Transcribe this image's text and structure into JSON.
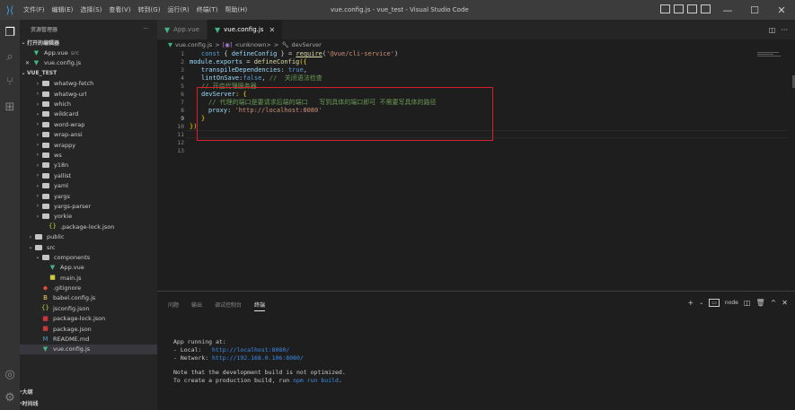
{
  "titlebar": {
    "menu": [
      "文件(F)",
      "编辑(E)",
      "选择(S)",
      "查看(V)",
      "转到(G)",
      "运行(R)",
      "终端(T)",
      "帮助(H)"
    ],
    "title": "vue.config.js - vue_test - Visual Studio Code",
    "minimize": "—",
    "maximize": "☐",
    "close": "✕"
  },
  "sidebar": {
    "header": "资源管理器",
    "more": "···",
    "open_editors_label": "打开的编辑器",
    "open_editors": [
      {
        "name": "App.vue",
        "sub": "src",
        "icon": "vue-icon",
        "modified_mark": ""
      },
      {
        "name": "vue.config.js",
        "sub": "",
        "icon": "vue-icon",
        "modified_mark": "✕"
      }
    ],
    "project_label": "VUE_TEST",
    "tree": [
      {
        "label": "whatwg-fetch",
        "indent": 1,
        "kind": "folder"
      },
      {
        "label": "whatwg-url",
        "indent": 1,
        "kind": "folder"
      },
      {
        "label": "which",
        "indent": 1,
        "kind": "folder"
      },
      {
        "label": "wildcard",
        "indent": 1,
        "kind": "folder"
      },
      {
        "label": "word-wrap",
        "indent": 1,
        "kind": "folder"
      },
      {
        "label": "wrap-ansi",
        "indent": 1,
        "kind": "folder"
      },
      {
        "label": "wrappy",
        "indent": 1,
        "kind": "folder"
      },
      {
        "label": "ws",
        "indent": 1,
        "kind": "folder"
      },
      {
        "label": "y18n",
        "indent": 1,
        "kind": "folder"
      },
      {
        "label": "yallist",
        "indent": 1,
        "kind": "folder"
      },
      {
        "label": "yaml",
        "indent": 1,
        "kind": "folder"
      },
      {
        "label": "yargs",
        "indent": 1,
        "kind": "folder"
      },
      {
        "label": "yargs-parser",
        "indent": 1,
        "kind": "folder"
      },
      {
        "label": "yorkie",
        "indent": 1,
        "kind": "folder"
      },
      {
        "label": ".package-lock.json",
        "indent": 2,
        "kind": "json"
      },
      {
        "label": "public",
        "indent": 0,
        "kind": "folder"
      },
      {
        "label": "src",
        "indent": 0,
        "kind": "folder-open"
      },
      {
        "label": "components",
        "indent": 1,
        "kind": "folder-open"
      },
      {
        "label": "App.vue",
        "indent": 2,
        "kind": "vue"
      },
      {
        "label": "main.js",
        "indent": 2,
        "kind": "js"
      },
      {
        "label": ".gitignore",
        "indent": 1,
        "kind": "git"
      },
      {
        "label": "babel.config.js",
        "indent": 1,
        "kind": "babel"
      },
      {
        "label": "jsconfig.json",
        "indent": 1,
        "kind": "jsconfig"
      },
      {
        "label": "package-lock.json",
        "indent": 1,
        "kind": "npm"
      },
      {
        "label": "package.json",
        "indent": 1,
        "kind": "npm"
      },
      {
        "label": "README.md",
        "indent": 1,
        "kind": "md"
      },
      {
        "label": "vue.config.js",
        "indent": 1,
        "kind": "vue",
        "active": true
      }
    ],
    "outline_label": "大纲",
    "timeline_label": "时间线"
  },
  "tabs": [
    {
      "label": "App.vue",
      "active": false,
      "close": ""
    },
    {
      "label": "vue.config.js",
      "active": true,
      "close": "✕"
    }
  ],
  "tab_actions": {
    "split": "◫",
    "more": "···"
  },
  "breadcrumb": {
    "file": "vue.config.js",
    "sep": ">",
    "scope": "<unknown>",
    "symbol": "devServer"
  },
  "editor": {
    "line_numbers": [
      "1",
      "2",
      "3",
      "4",
      "5",
      "6",
      "7",
      "8",
      "9",
      "10",
      "11",
      "12",
      "13"
    ],
    "code": {
      "l1_kw": "const",
      "l1_a": " { ",
      "l1_var": "defineConfig",
      "l1_b": " } = ",
      "l1_fn": "require",
      "l1_c": "(",
      "l1_str": "'@vue/cli-service'",
      "l1_d": ")",
      "l2_var": "module",
      "l2_a": ".",
      "l2_var2": "exports",
      "l2_b": " = ",
      "l2_fn": "defineConfig",
      "l2_c": "({",
      "l3_var": "transpileDependencies",
      "l3_a": ": ",
      "l3_bool": "true",
      "l3_b": ",",
      "l4_var": "lintOnSave",
      "l4_a": ":",
      "l4_bool": "false",
      "l4_b": ", ",
      "l4_cmt": "//  关闭语法检查",
      "l5_cmt": "// 开启代理服务器",
      "l6_var": "devServer",
      "l6_a": ": {",
      "l7_cmt": "// 代理的端口是要请求后端的端口   写到具体的端口即可 不需要写具体的路径",
      "l8_var": "proxy",
      "l8_a": ": ",
      "l8_str": "'http://localhost:8080'",
      "l9_a": "}",
      "l10_a": "})"
    }
  },
  "panel": {
    "tabs": [
      "问题",
      "输出",
      "调试控制台",
      "终端"
    ],
    "active_tab": "终端",
    "actions": {
      "add": "+",
      "dropdown": "⌄",
      "shell_label": "node",
      "split": "◫",
      "trash": "🗑",
      "maximize": "^",
      "close": "✕"
    },
    "terminal": {
      "l1": "App running at:",
      "l2_a": "- Local:   ",
      "l2_url": "http://localhost:8080/",
      "l3_a": "- Network: ",
      "l3_url": "http://192.168.0.106:8080/",
      "l4": "Note that the development build is not optimized.",
      "l5_a": "To create a production build, run ",
      "l5_cmd": "npm run build",
      "l5_b": "."
    }
  },
  "colors": {
    "accent": "#007acc",
    "vue": "#41b883",
    "highlight_box": "#d8202a"
  }
}
